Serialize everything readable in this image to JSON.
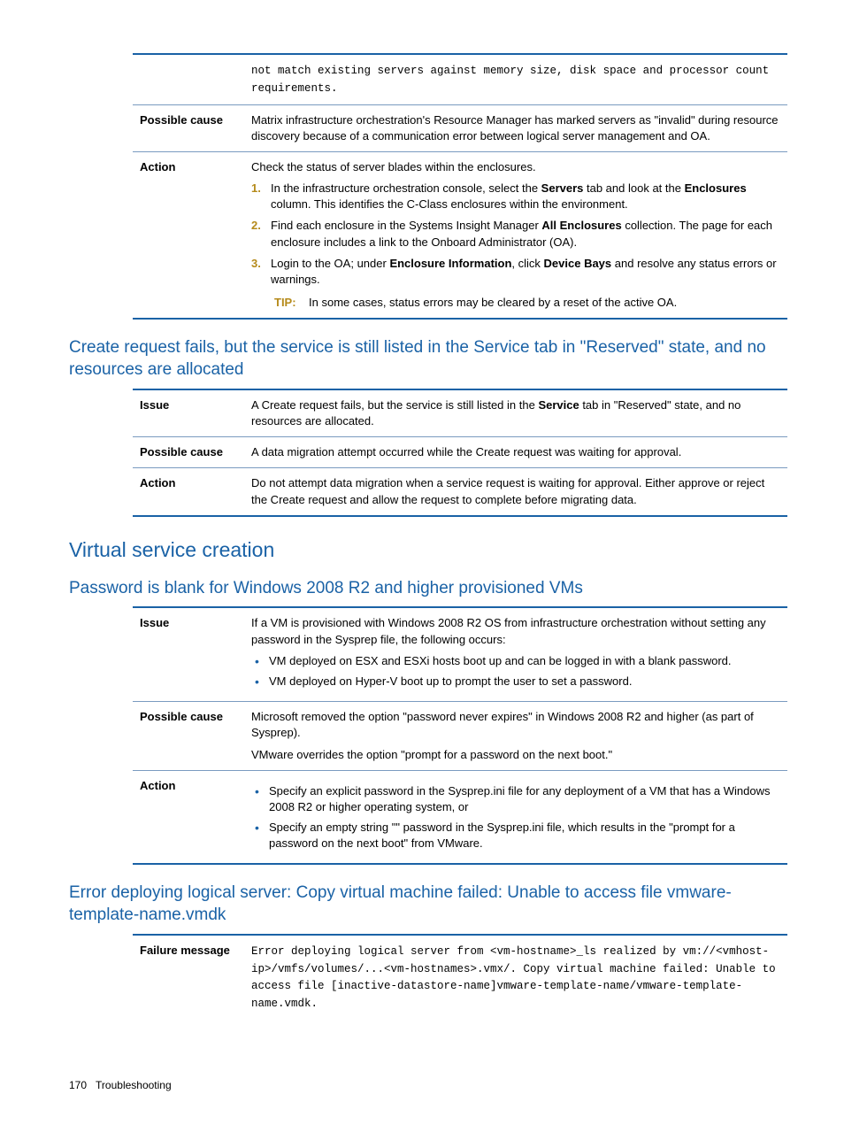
{
  "table1": {
    "row0_content_code": "not match existing servers against memory size, disk space and processor count requirements.",
    "row1_label": "Possible cause",
    "row1_content": "Matrix infrastructure orchestration's Resource Manager has marked servers as \"invalid\" during resource discovery because of a communication error between logical server management and OA.",
    "row2_label": "Action",
    "row2_intro": "Check the status of server blades within the enclosures.",
    "row2_step1_pre": "In the infrastructure orchestration console, select the ",
    "row2_step1_b1": "Servers",
    "row2_step1_mid": " tab and look at the ",
    "row2_step1_b2": "Enclosures",
    "row2_step1_post": " column. This identifies the C-Class enclosures within the environment.",
    "row2_step2_pre": "Find each enclosure in the Systems Insight Manager ",
    "row2_step2_b1": "All Enclosures",
    "row2_step2_post": " collection. The page for each enclosure includes a link to the Onboard Administrator (OA).",
    "row2_step3_pre": "Login to the OA; under ",
    "row2_step3_b1": "Enclosure Information",
    "row2_step3_mid": ", click ",
    "row2_step3_b2": "Device Bays",
    "row2_step3_post": " and resolve any status errors or warnings.",
    "row2_tip_label": "TIP:",
    "row2_tip_text": "In some cases, status errors may be cleared by a reset of the active OA."
  },
  "heading_a": "Create request fails, but the service is still listed in the Service tab in \"Reserved\" state, and no resources are allocated",
  "table2": {
    "row0_label": "Issue",
    "row0_pre": "A Create request fails, but the service is still listed in the ",
    "row0_b1": "Service",
    "row0_post": " tab in \"Reserved\" state, and no resources are allocated.",
    "row1_label": "Possible cause",
    "row1_content": "A data migration attempt occurred while the Create request was waiting for approval.",
    "row2_label": "Action",
    "row2_content": "Do not attempt data migration when a service request is waiting for approval. Either approve or reject the Create request and allow the request to complete before migrating data."
  },
  "heading_b": "Virtual service creation",
  "heading_c": "Password is blank for Windows 2008 R2 and higher provisioned VMs",
  "table3": {
    "row0_label": "Issue",
    "row0_intro": "If a VM is provisioned with Windows 2008 R2 OS from infrastructure orchestration without setting any password in the Sysprep file, the following occurs:",
    "row0_b1": "VM deployed on ESX and ESXi hosts boot up and can be logged in with a blank password.",
    "row0_b2": "VM deployed on Hyper-V boot up to prompt the user to set a password.",
    "row1_label": "Possible cause",
    "row1_l1": "Microsoft removed the option \"password never expires\" in Windows 2008 R2 and higher (as part of Sysprep).",
    "row1_l2": "VMware overrides the option \"prompt for a password on the next boot.\"",
    "row2_label": "Action",
    "row2_b1": "Specify an explicit password in the Sysprep.ini file for any deployment of a VM that has a Windows 2008 R2 or higher operating system, or",
    "row2_b2": "Specify an empty string \"\" password in the Sysprep.ini file, which results in the \"prompt for a password on the next boot\" from VMware."
  },
  "heading_d": "Error deploying logical server: Copy virtual machine failed: Unable to access file vmware-template-name.vmdk",
  "table4": {
    "row0_label": "Failure message",
    "row0_code": "Error deploying logical server from <vm-hostname>_ls realized by vm://<vmhost-ip>/vmfs/volumes/...<vm-hostnames>.vmx/. Copy virtual machine failed: Unable to access file [inactive-datastore-name]vmware-template-name/vmware-template-name.vmdk."
  },
  "footer": {
    "page": "170",
    "section": "Troubleshooting"
  },
  "nums": {
    "n1": "1.",
    "n2": "2.",
    "n3": "3."
  }
}
